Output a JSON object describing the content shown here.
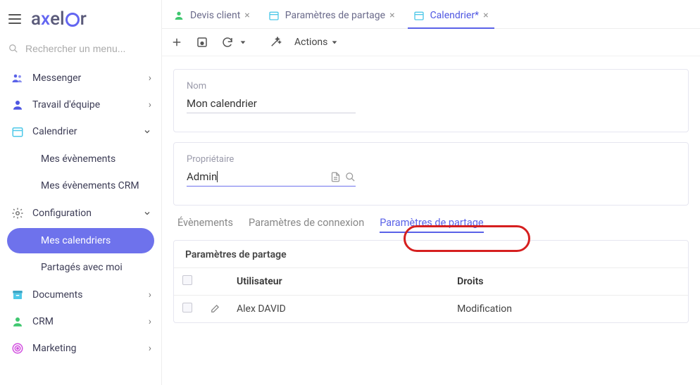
{
  "search": {
    "placeholder": "Rechercher un menu..."
  },
  "nav": {
    "messenger": "Messenger",
    "team": "Travail d'équipe",
    "calendar": "Calendrier",
    "cal_sub": {
      "events": "Mes évènements",
      "events_crm": "Mes évènements CRM"
    },
    "config": "Configuration",
    "config_sub": {
      "mycals": "Mes calendriers",
      "shared": "Partagés avec moi"
    },
    "documents": "Documents",
    "crm": "CRM",
    "marketing": "Marketing"
  },
  "tabs": {
    "t1": "Devis client",
    "t2": "Paramètres de partage",
    "t3": "Calendrier*"
  },
  "toolbar": {
    "actions": "Actions"
  },
  "form": {
    "name_label": "Nom",
    "name_value": "Mon calendrier",
    "owner_label": "Propriétaire",
    "owner_value": "Admin"
  },
  "subtabs": {
    "events": "Évènements",
    "conn": "Paramètres de connexion",
    "share": "Paramètres de partage"
  },
  "panel": {
    "title": "Paramètres de partage",
    "col_user": "Utilisateur",
    "col_rights": "Droits",
    "rows": [
      {
        "user": "Alex DAVID",
        "rights": "Modification"
      }
    ]
  }
}
